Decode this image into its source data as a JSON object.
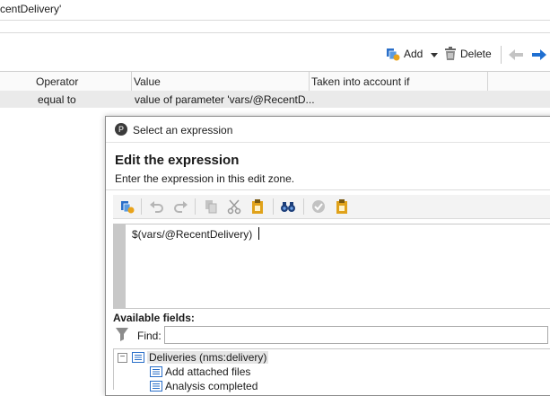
{
  "top_field": {
    "value": "centDelivery'"
  },
  "toolbar": {
    "add_label": "Add",
    "delete_label": "Delete"
  },
  "grid": {
    "columns": [
      "Operator",
      "Value",
      "Taken into account if"
    ],
    "rows": [
      {
        "operator": "equal to",
        "value": "value of parameter 'vars/@RecentD..."
      }
    ]
  },
  "dialog": {
    "window_title": "Select an expression",
    "heading": "Edit the expression",
    "subheading": "Enter the expression in this edit zone.",
    "expression": "$(vars/@RecentDelivery)",
    "available_fields_label": "Available fields:",
    "find_label": "Find:",
    "find_value": "",
    "tree": [
      {
        "label": "Deliveries (nms:delivery)",
        "expanded": true,
        "children": [
          "Add attached files",
          "Analysis completed"
        ]
      }
    ]
  },
  "colors": {
    "accent_blue": "#1f6fd1",
    "gold": "#e0a21a",
    "selected_row": "#eaeaea"
  }
}
